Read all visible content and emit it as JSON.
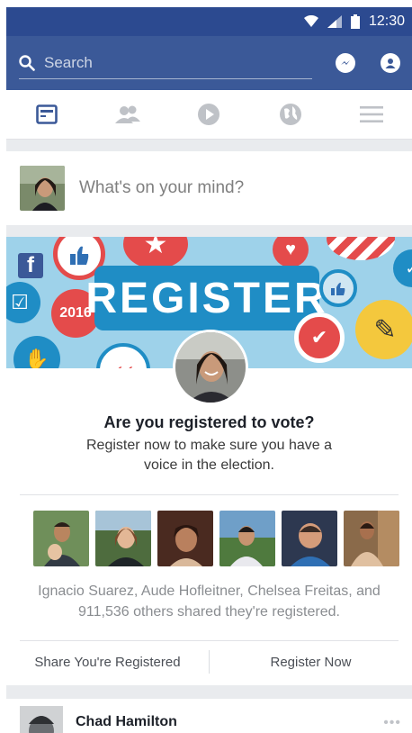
{
  "status_bar": {
    "time": "12:30"
  },
  "header": {
    "search_placeholder": "Search"
  },
  "composer": {
    "prompt": "What's on your mind?"
  },
  "register_card": {
    "banner_text": "REGISTER",
    "badge_year": "2016",
    "title": "Are you registered to vote?",
    "subtitle": "Register now to make sure you have a voice in the election.",
    "shared_text": "Ignacio Suarez, Aude Hofleitner, Chelsea Freitas, and 911,536 others shared they're registered.",
    "share_button": "Share You're Registered",
    "register_button": "Register Now"
  },
  "next_post": {
    "author": "Chad Hamilton"
  },
  "colors": {
    "brand": "#3b5998",
    "status": "#2c4a90",
    "banner": "#9ed2ea"
  }
}
